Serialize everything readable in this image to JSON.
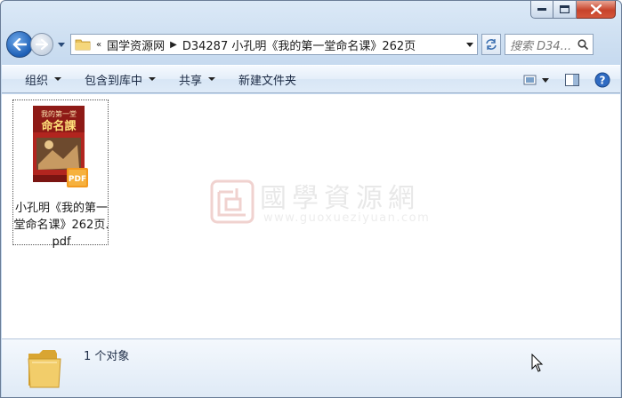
{
  "window": {
    "caption_buttons": [
      "minimize",
      "maximize",
      "close"
    ]
  },
  "address": {
    "overflow": "«",
    "crumbs": [
      "国学资源网",
      "D34287 小孔明《我的第一堂命名课》262页"
    ]
  },
  "search": {
    "placeholder": "搜索 D34..."
  },
  "toolbar": {
    "organize": "组织",
    "include_library": "包含到库中",
    "share": "共享",
    "new_folder": "新建文件夹"
  },
  "file": {
    "name": "小孔明《我的第一堂命名课》262页.pdf",
    "thumb_title_1": "我的第一堂",
    "thumb_title_2": "命名課",
    "badge": "PDF"
  },
  "watermark": {
    "title": "國學資源網",
    "url": "www.guoxueziyuan.com"
  },
  "status": {
    "count": "1 个对象"
  },
  "colors": {
    "accent": "#1d5fb6",
    "close": "#c7432b",
    "pdf_badge": "#f39a1f"
  }
}
